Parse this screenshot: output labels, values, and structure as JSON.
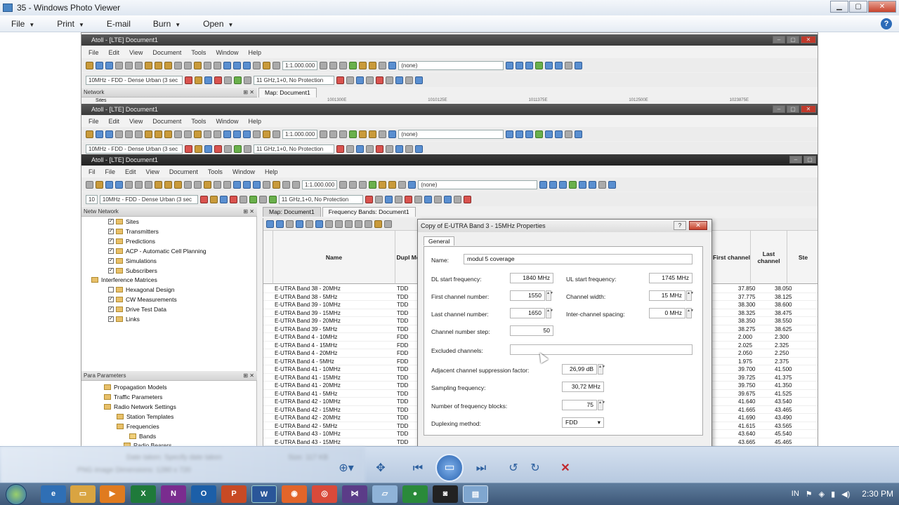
{
  "window": {
    "title": "35 - Windows Photo Viewer"
  },
  "viewer_menu": [
    {
      "label": "File",
      "arrow": "▼"
    },
    {
      "label": "Print",
      "arrow": "▼"
    },
    {
      "label": "E-mail",
      "arrow": ""
    },
    {
      "label": "Burn",
      "arrow": "▼"
    },
    {
      "label": "Open",
      "arrow": "▼"
    }
  ],
  "help": "?",
  "atoll": {
    "title": "Atoll - [LTE] Document1",
    "menu": [
      "File",
      "Edit",
      "View",
      "Document",
      "Tools",
      "Window",
      "Help"
    ],
    "menu3": [
      "Fil",
      "File",
      "Edit",
      "View",
      "Document",
      "Tools",
      "Window",
      "Help"
    ],
    "scale": "1:1.000.000",
    "layer": "(none)",
    "template": "10MHz - FDD - Dense Urban (3 sec",
    "template3": "10MHz - FDD - Dense Urban (3 sec",
    "prefix3": "10",
    "propagation": "11 GHz,1+0, No Protection",
    "network_label": "Network",
    "network_label3": "Netw Network",
    "map_tab": "Map: Document1",
    "bands_tab": "Frequency Bands: Document1",
    "sites_cut": "Sites",
    "ruler": [
      "1001300E",
      "1010125E",
      "1011375E",
      "1012500E",
      "1023875E"
    ]
  },
  "tree": [
    {
      "label": "Sites",
      "checked": true
    },
    {
      "label": "Transmitters",
      "checked": true
    },
    {
      "label": "Predictions",
      "checked": true
    },
    {
      "label": "ACP - Automatic Cell Planning",
      "checked": true
    },
    {
      "label": "Simulations",
      "checked": true
    },
    {
      "label": "Subscribers",
      "checked": true
    },
    {
      "label": "Interference Matrices",
      "checked": false
    },
    {
      "label": "Hexagonal Design",
      "checked": false
    },
    {
      "label": "CW Measurements",
      "checked": true
    },
    {
      "label": "Drive Test Data",
      "checked": true
    },
    {
      "label": "Links",
      "checked": true
    }
  ],
  "params": {
    "header": "Para Parameters",
    "items": [
      "Propagation Models",
      "Traffic Parameters",
      "Radio Network Settings",
      "Station Templates",
      "Frequencies",
      "Bands",
      "Radio Bearers"
    ]
  },
  "grid": {
    "headers": {
      "name": "Name",
      "dup": "Dupl Met",
      "first": "First channel",
      "last": "Last channel",
      "step": "Ste"
    },
    "rows": [
      [
        "E-UTRA Band 38 - 20MHz",
        "TDD",
        "37.850",
        "38.050"
      ],
      [
        "E-UTRA Band 38 - 5MHz",
        "TDD",
        "37.775",
        "38.125"
      ],
      [
        "E-UTRA Band 39 - 10MHz",
        "TDD",
        "38.300",
        "38.600"
      ],
      [
        "E-UTRA Band 39 - 15MHz",
        "TDD",
        "38.325",
        "38.475"
      ],
      [
        "E-UTRA Band 39 - 20MHz",
        "TDD",
        "38.350",
        "38.550"
      ],
      [
        "E-UTRA Band 39 - 5MHz",
        "TDD",
        "38.275",
        "38.625"
      ],
      [
        "E-UTRA Band 4 - 10MHz",
        "FDD",
        "2.000",
        "2.300"
      ],
      [
        "E-UTRA Band 4 - 15MHz",
        "FDD",
        "2.025",
        "2.325"
      ],
      [
        "E-UTRA Band 4 - 20MHz",
        "FDD",
        "2.050",
        "2.250"
      ],
      [
        "E-UTRA Band 4 - 5MHz",
        "FDD",
        "1.975",
        "2.375"
      ],
      [
        "E-UTRA Band 41 - 10MHz",
        "TDD",
        "39.700",
        "41.500"
      ],
      [
        "E-UTRA Band 41 - 15MHz",
        "TDD",
        "39.725",
        "41.375"
      ],
      [
        "E-UTRA Band 41 - 20MHz",
        "TDD",
        "39.750",
        "41.350"
      ],
      [
        "E-UTRA Band 41 - 5MHz",
        "TDD",
        "39.675",
        "41.525"
      ],
      [
        "E-UTRA Band 42 - 10MHz",
        "TDD",
        "41.640",
        "43.540"
      ],
      [
        "E-UTRA Band 42 - 15MHz",
        "TDD",
        "41.665",
        "43.465"
      ],
      [
        "E-UTRA Band 42 - 20MHz",
        "TDD",
        "41.690",
        "43.490"
      ],
      [
        "E-UTRA Band 42 - 5MHz",
        "TDD",
        "41.615",
        "43.565"
      ],
      [
        "E-UTRA Band 43 - 10MHz",
        "TDD",
        "43.640",
        "45.540"
      ],
      [
        "E-UTRA Band 43 - 15MHz",
        "TDD",
        "43.665",
        "45.465"
      ]
    ]
  },
  "dialog": {
    "title": "Copy of E-UTRA Band 3 - 15MHz Properties",
    "tab": "General",
    "name_label": "Name:",
    "name_value": "modul 5 coverage",
    "dl_label": "DL start frequency:",
    "dl_value": "1840 MHz",
    "ul_label": "UL start frequency:",
    "ul_value": "1745 MHz",
    "first_label": "First channel number:",
    "first_value": "1550",
    "cw_label": "Channel width:",
    "cw_value": "15 MHz",
    "last_label": "Last channel number:",
    "last_value": "1650",
    "ics_label": "Inter-channel spacing:",
    "ics_value": "0 MHz",
    "step_label": "Channel number step:",
    "step_value": "50",
    "excl_label": "Excluded channels:",
    "adj_label": "Adjacent channel suppression factor:",
    "adj_value": "26,99 dB",
    "samp_label": "Sampling frequency:",
    "samp_value": "30,72 MHz",
    "blocks_label": "Number of frequency blocks:",
    "blocks_value": "75",
    "dup_label": "Duplexing method:",
    "dup_value": "FDD",
    "help_btn": "?",
    "close_btn": "✕"
  },
  "viewer_controls": {
    "blur_text": [
      "Date taken: Specify date taken",
      "PNG image  Dimensions: 1280 x 720",
      "Size: 117 KB"
    ]
  },
  "tray": {
    "lang": "IN",
    "time": "2:30 PM"
  }
}
